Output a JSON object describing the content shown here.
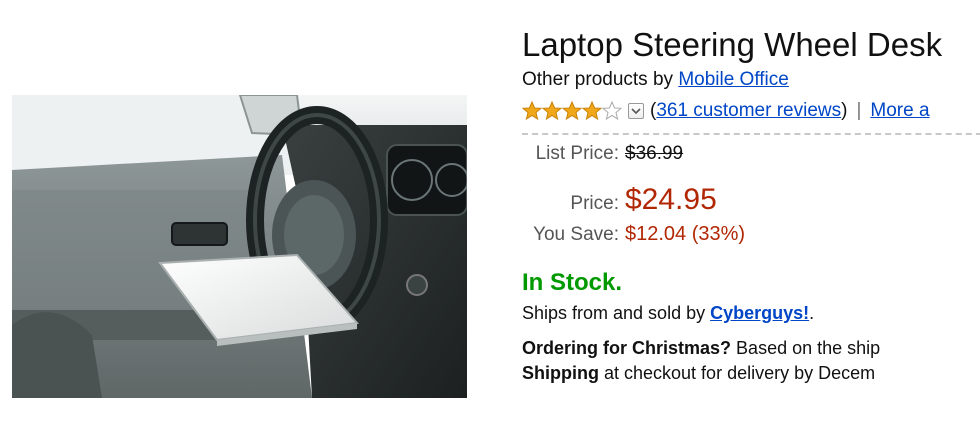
{
  "product": {
    "title": "Laptop Steering Wheel Desk",
    "byline_prefix": "Other products by",
    "brand_link": "Mobile Office"
  },
  "rating": {
    "stars": 4,
    "max_stars": 5,
    "reviews_link": "361 customer reviews",
    "paren_open": "(",
    "paren_close": ")",
    "separator": "|",
    "more_link": "More a"
  },
  "pricing": {
    "list_label": "List Price:",
    "list_value": "$36.99",
    "price_label": "Price:",
    "price_value": "$24.95",
    "save_label": "You Save:",
    "save_value": "$12.04 (33%)"
  },
  "availability": {
    "status": "In Stock.",
    "ships_prefix": "Ships from and sold by",
    "seller_link": "Cyberguys!",
    "ships_suffix": "."
  },
  "shipping_note": {
    "line1_bold": "Ordering for Christmas?",
    "line1_rest": "Based on the ship",
    "line2_bold": "Shipping",
    "line2_rest": "at checkout for delivery by Decem"
  },
  "colors": {
    "link": "#0046c7",
    "price": "#b12704",
    "in_stock": "#009900",
    "star": "#f0a81a"
  }
}
